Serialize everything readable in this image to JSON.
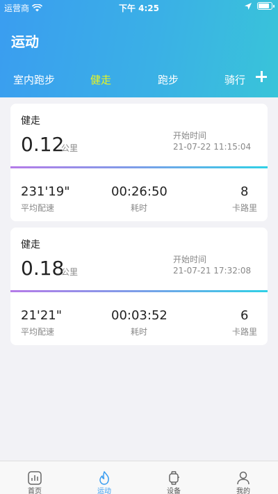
{
  "status": {
    "carrier": "运营商",
    "time": "下午 4:25"
  },
  "header": {
    "title": "运动"
  },
  "tabs": [
    {
      "label": "室内跑步",
      "active": false
    },
    {
      "label": "健走",
      "active": true
    },
    {
      "label": "跑步",
      "active": false
    },
    {
      "label": "骑行",
      "active": false
    }
  ],
  "records": [
    {
      "type": "健走",
      "distance": "0.12",
      "distance_unit": "公里",
      "start_label": "开始时间",
      "start_time": "21-07-22 11:15:04",
      "pace": "231'19\"",
      "pace_label": "平均配速",
      "duration": "00:26:50",
      "duration_label": "耗时",
      "calories": "8",
      "calories_label": "卡路里"
    },
    {
      "type": "健走",
      "distance": "0.18",
      "distance_unit": "公里",
      "start_label": "开始时间",
      "start_time": "21-07-21 17:32:08",
      "pace": "21'21\"",
      "pace_label": "平均配速",
      "duration": "00:03:52",
      "duration_label": "耗时",
      "calories": "6",
      "calories_label": "卡路里"
    }
  ],
  "tabbar": [
    {
      "label": "首页",
      "icon": "chart-icon",
      "active": false
    },
    {
      "label": "运动",
      "icon": "flame-icon",
      "active": true
    },
    {
      "label": "设备",
      "icon": "watch-icon",
      "active": false
    },
    {
      "label": "我的",
      "icon": "person-icon",
      "active": false
    }
  ],
  "colors": {
    "accent": "#3a9df0",
    "active_tab": "#e8f520",
    "header_gradient_start": "#3a9df0",
    "header_gradient_end": "#39c4d9"
  }
}
